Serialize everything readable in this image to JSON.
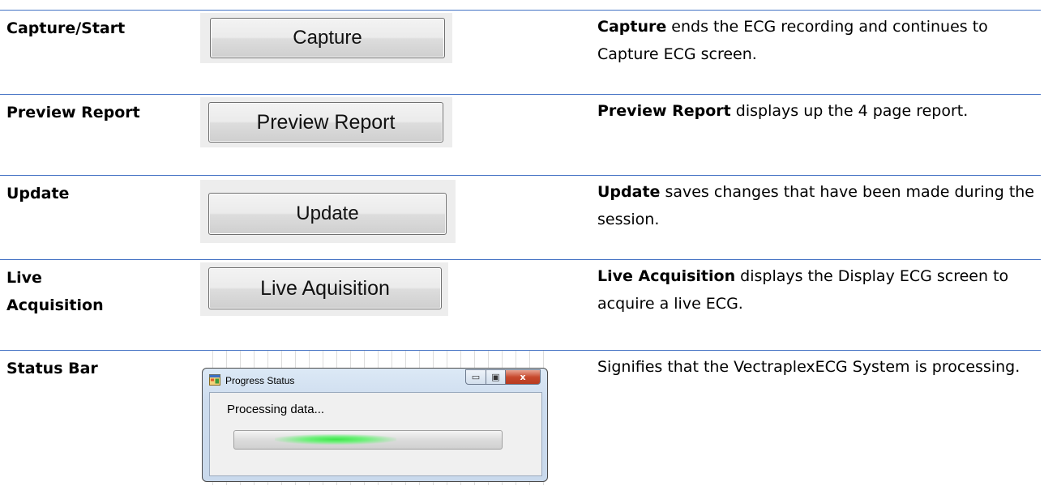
{
  "rows": [
    {
      "term": "Capture/Start",
      "button_label": "Capture",
      "desc_bold": "Capture",
      "desc_rest": " ends the ECG recording and continues to Capture ECG screen."
    },
    {
      "term": "Preview Report",
      "button_label": "Preview Report",
      "desc_bold": "Preview Report",
      "desc_rest": " displays up the 4 page report."
    },
    {
      "term": "Update",
      "button_label": "Update",
      "desc_bold": "Update",
      "desc_rest": " saves changes that have been made during the session."
    },
    {
      "term_line1": "Live",
      "term_line2": "Acquisition",
      "button_label": "Live Aquisition",
      "desc_bold": "Live Acquisition",
      "desc_rest": " displays the Display ECG screen to acquire a live ECG."
    },
    {
      "term": "Status Bar",
      "desc": "Signifies that the VectraplexECG System is processing."
    }
  ],
  "progress_window": {
    "title": "Progress Status",
    "message": "Processing data...",
    "minimize_glyph": "▭",
    "maximize_glyph": "▣",
    "close_glyph": "x",
    "progress_level": 0.38
  },
  "colors": {
    "rule": "#4472c4",
    "progress_green": "#3ee64a",
    "close_red": "#c74a2e"
  }
}
